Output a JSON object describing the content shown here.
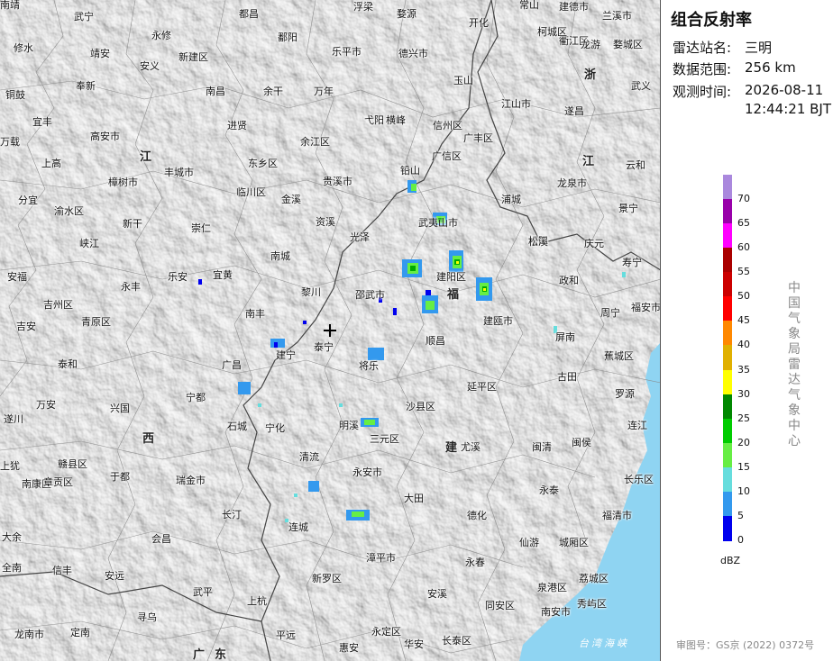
{
  "panel": {
    "title": "组合反射率",
    "station_label": "雷达站名:",
    "station_value": "三明",
    "range_label": "数据范围:",
    "range_value": "256 km",
    "time_label": "观测时间:",
    "time_date": "2026-08-11",
    "time_clock": "12:44:21 BJT",
    "unit": "dBZ",
    "agency_chars": [
      "中",
      "国",
      "气",
      "象",
      "局",
      "雷",
      "达",
      "气",
      "象",
      "中",
      "心"
    ],
    "review_no": "审图号：GS京 (2022) 0372号"
  },
  "colorbar": [
    {
      "label": "70",
      "color": "#aa88dd"
    },
    {
      "label": "65",
      "color": "#9900aa"
    },
    {
      "label": "60",
      "color": "#ff00ff"
    },
    {
      "label": "55",
      "color": "#aa0000"
    },
    {
      "label": "50",
      "color": "#cc0000"
    },
    {
      "label": "45",
      "color": "#ff0000"
    },
    {
      "label": "40",
      "color": "#ff8800"
    },
    {
      "label": "35",
      "color": "#e0b000"
    },
    {
      "label": "30",
      "color": "#ffff00"
    },
    {
      "label": "25",
      "color": "#008800"
    },
    {
      "label": "20",
      "color": "#00cc00"
    },
    {
      "label": "15",
      "color": "#66ee44"
    },
    {
      "label": "10",
      "color": "#66dddd"
    },
    {
      "label": "5",
      "color": "#3399ee"
    },
    {
      "label": "0",
      "color": "#0000ee"
    }
  ],
  "map": {
    "provinces": [
      "江",
      "西",
      "福",
      "建",
      "浙",
      "江",
      "广",
      "东"
    ],
    "sea_label": "台湾海峡",
    "places": [
      "武宁",
      "都昌",
      "浮梁",
      "婺源",
      "开化",
      "建德市",
      "兰溪市",
      "修水",
      "永修",
      "鄱阳",
      "乐平市",
      "德兴市",
      "常山",
      "衢江区",
      "龙游",
      "婺城区",
      "靖安",
      "安义",
      "新建区",
      "余干",
      "万年",
      "玉山",
      "柯城区",
      "铜鼓",
      "奉新",
      "南昌",
      "弋阳",
      "横峰",
      "信州区",
      "江山市",
      "遂昌",
      "武义",
      "宜丰",
      "高安市",
      "进贤",
      "贵溪市",
      "广丰区",
      "松阳",
      "万载",
      "上高",
      "丰城市",
      "东乡区",
      "余江区",
      "广信区",
      "龙泉市",
      "云和",
      "樟树市",
      "临川区",
      "金溪",
      "铅山",
      "浦城",
      "分宜",
      "渝水区",
      "新干",
      "崇仁",
      "资溪",
      "光泽",
      "武夷山市",
      "松溪",
      "庆元",
      "景宁",
      "峡江",
      "南城",
      "建阳区",
      "政和",
      "寿宁",
      "安福",
      "吉州区",
      "永丰",
      "乐安",
      "宜黄",
      "黎川",
      "邵武市",
      "建瓯市",
      "周宁",
      "吉安",
      "青原区",
      "南丰",
      "泰宁",
      "顺昌",
      "屏南",
      "福安市",
      "泰和",
      "广昌",
      "建宁",
      "将乐",
      "延平区",
      "古田",
      "蕉城区",
      "万安",
      "兴国",
      "宁都",
      "沙县区",
      "罗源",
      "遂川",
      "石城",
      "宁化",
      "明溪",
      "三元区",
      "尤溪",
      "闽清",
      "闽侯",
      "连江",
      "赣县区",
      "于都",
      "瑞金市",
      "清流",
      "永安市",
      "长乐区",
      "上犹",
      "南康区",
      "章贡区",
      "大田",
      "永泰",
      "长汀",
      "连城",
      "德化",
      "福清市",
      "大余",
      "会昌",
      "漳平市",
      "永春",
      "仙游",
      "城厢区",
      "信丰",
      "安远",
      "新罗区",
      "安溪",
      "荔城区",
      "全南",
      "武平",
      "上杭",
      "泉港区",
      "秀屿区",
      "龙南市",
      "定南",
      "寻乌",
      "平远",
      "永定区",
      "华安",
      "长泰区",
      "同安区",
      "南安市",
      "惠安",
      "南靖"
    ]
  }
}
